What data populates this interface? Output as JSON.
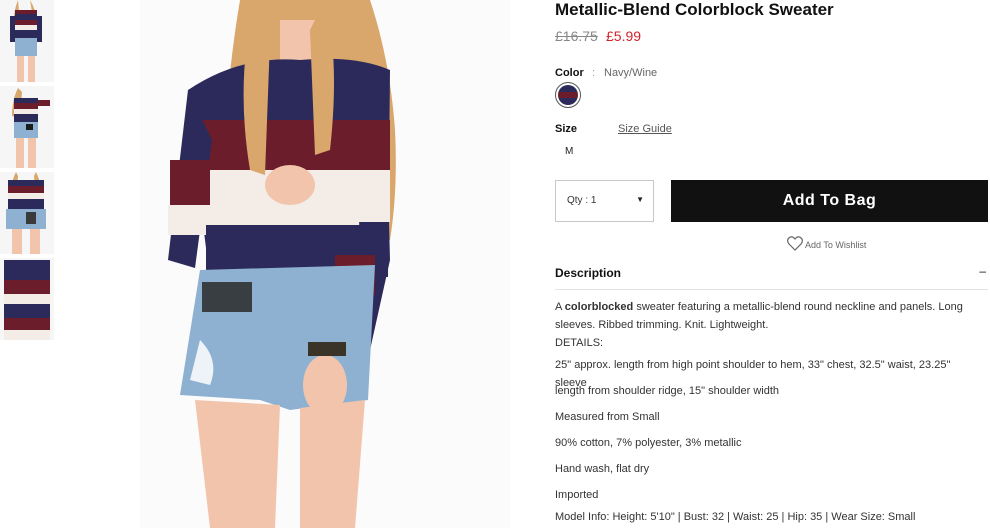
{
  "product": {
    "title": "Metallic-Blend Colorblock Sweater",
    "price_original": "£16.75",
    "price_sale": "£5.99"
  },
  "color": {
    "label": "Color",
    "separator": ":",
    "value": "Navy/Wine",
    "swatch_colors": [
      "#2b2a5a",
      "#6e1f2c"
    ]
  },
  "size": {
    "label": "Size",
    "guide_link": "Size Guide",
    "options": [
      "M"
    ]
  },
  "quantity": {
    "label": "Qty : 1",
    "caret": "▼"
  },
  "actions": {
    "add_to_bag": "Add To Bag",
    "wishlist": "Add To Wishlist"
  },
  "description": {
    "heading": "Description",
    "toggle": "–",
    "intro_bold": "colorblocked",
    "intro_prefix": "A ",
    "intro_rest": " sweater featuring a metallic-blend round neckline and panels. Long",
    "line2": "sleeves. Ribbed trimming. Knit. Lightweight.",
    "details_label": "DETAILS:",
    "measure_line1": "25\" approx. length from high point shoulder to hem, 33\" chest, 32.5\" waist, 23.25\" sleeve",
    "measure_line2": "length from shoulder ridge, 15\" shoulder width",
    "measured_from": "Measured from Small",
    "composition": "90% cotton, 7% polyester, 3% metallic",
    "care": "Hand wash, flat dry",
    "origin": "Imported",
    "model_info": "Model Info: Height: 5'10\" | Bust: 32 | Waist: 25 | Hip: 35 | Wear Size: Small"
  },
  "colors": {
    "navy": "#2b2a5a",
    "wine": "#6b1d2b",
    "cream": "#f4ece6",
    "denim": "#8fb1d1",
    "skin": "#f2c4ac",
    "hair": "#d9a66c",
    "sale_red": "#d2232a"
  }
}
